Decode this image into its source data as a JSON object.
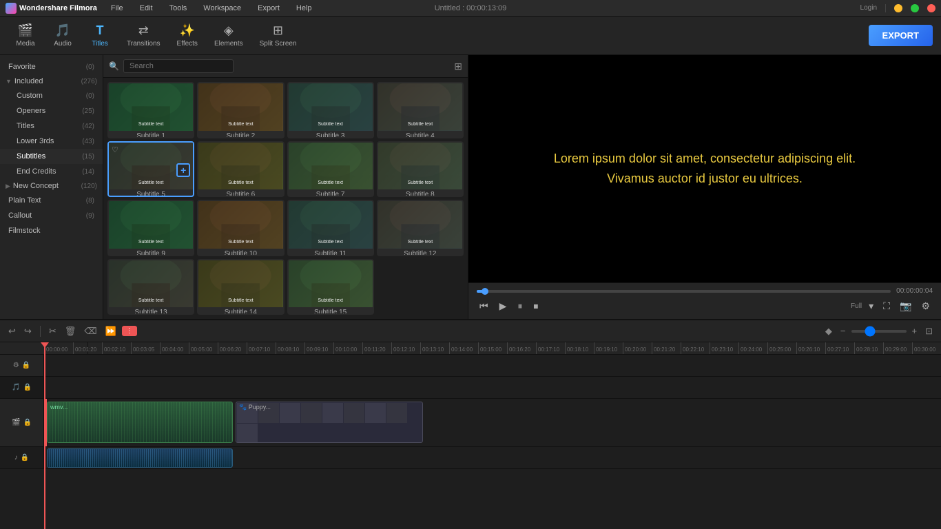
{
  "app": {
    "name": "Wondershare Filmora",
    "title": "Untitled : 00:00:13:09"
  },
  "menu": {
    "items": [
      "File",
      "Edit",
      "Tools",
      "Workspace",
      "Export",
      "Help"
    ]
  },
  "toolbar": {
    "items": [
      {
        "id": "media",
        "label": "Media",
        "icon": "🎬"
      },
      {
        "id": "audio",
        "label": "Audio",
        "icon": "🎵"
      },
      {
        "id": "titles",
        "label": "Titles",
        "icon": "T",
        "active": true
      },
      {
        "id": "transitions",
        "label": "Transitions",
        "icon": "⇄"
      },
      {
        "id": "effects",
        "label": "Effects",
        "icon": "✨"
      },
      {
        "id": "elements",
        "label": "Elements",
        "icon": "◈"
      },
      {
        "id": "split_screen",
        "label": "Split Screen",
        "icon": "⊞"
      }
    ],
    "export_label": "EXPORT"
  },
  "sidebar": {
    "items": [
      {
        "id": "favorite",
        "label": "Favorite",
        "count": "0",
        "expandable": false
      },
      {
        "id": "included",
        "label": "Included",
        "count": "276",
        "expandable": true,
        "expanded": true
      },
      {
        "id": "custom",
        "label": "Custom",
        "count": "0",
        "indent": true
      },
      {
        "id": "openers",
        "label": "Openers",
        "count": "25",
        "indent": true
      },
      {
        "id": "titles",
        "label": "Titles",
        "count": "42",
        "indent": true
      },
      {
        "id": "lower3rds",
        "label": "Lower 3rds",
        "count": "43",
        "indent": true
      },
      {
        "id": "subtitles",
        "label": "Subtitles",
        "count": "15",
        "indent": true,
        "active": true
      },
      {
        "id": "end_credits",
        "label": "End Credits",
        "count": "14",
        "indent": true
      },
      {
        "id": "new_concept",
        "label": "New Concept",
        "count": "120",
        "expandable": true
      },
      {
        "id": "plain_text",
        "label": "Plain Text",
        "count": "8"
      },
      {
        "id": "callout",
        "label": "Callout",
        "count": "9"
      },
      {
        "id": "filmstock",
        "label": "Filmstock",
        "count": ""
      }
    ]
  },
  "search": {
    "placeholder": "Search"
  },
  "tiles": [
    {
      "id": 1,
      "label": "Subtitle 1",
      "selected": false
    },
    {
      "id": 2,
      "label": "Subtitle 2",
      "selected": false
    },
    {
      "id": 3,
      "label": "Subtitle 3",
      "selected": false
    },
    {
      "id": 4,
      "label": "Subtitle 4",
      "selected": false
    },
    {
      "id": 5,
      "label": "Subtitle 5",
      "selected": true,
      "add_visible": true
    },
    {
      "id": 6,
      "label": "Subtitle 6",
      "selected": false
    },
    {
      "id": 7,
      "label": "Subtitle 7",
      "selected": false
    },
    {
      "id": 8,
      "label": "Subtitle 8",
      "selected": false
    },
    {
      "id": 9,
      "label": "Subtitle 9",
      "selected": false
    },
    {
      "id": 10,
      "label": "Subtitle 10",
      "selected": false
    },
    {
      "id": 11,
      "label": "Subtitle 11",
      "selected": false
    },
    {
      "id": 12,
      "label": "Subtitle 12",
      "selected": false
    },
    {
      "id": 13,
      "label": "Subtitle 13",
      "selected": false
    },
    {
      "id": 14,
      "label": "Subtitle 14",
      "selected": false
    },
    {
      "id": 15,
      "label": "Subtitle 15",
      "selected": false
    }
  ],
  "preview": {
    "text_line1": "Lorem ipsum dolor sit amet, consectetur adipiscing elit.",
    "text_line2": "Vivamus auctor id justor eu ultrices.",
    "time_current": "00:00:00:04",
    "time_total": "",
    "progress_percent": 2,
    "zoom_label": "Full"
  },
  "timeline": {
    "toolbar_buttons": [
      "undo",
      "redo",
      "cut",
      "delete",
      "ripple_delete",
      "speed",
      "split"
    ],
    "ruler_marks": [
      "00:00:00",
      "00:01:20",
      "00:02:10",
      "00:03:05",
      "00:04:00",
      "00:05:00",
      "00:06:20",
      "00:07:10",
      "00:08:10",
      "00:09:10",
      "00:10:00",
      "00:11:20",
      "00:12:10",
      "00:13:10",
      "00:14:00",
      "00:15:00",
      "00:16:20",
      "00:17:10",
      "00:18:10",
      "00:19:10",
      "00:20:00",
      "00:21:20",
      "00:22:10",
      "00:23:10",
      "00:24:00",
      "00:25:00",
      "00:26:10",
      "00:27:10",
      "00:28:10",
      "00:29:00",
      "00:30:00"
    ],
    "tracks": [
      {
        "id": "track_empty1",
        "type": "empty"
      },
      {
        "id": "track_main",
        "type": "video",
        "has_clip": true,
        "clip_label": "main_clip"
      },
      {
        "id": "track_puppy",
        "type": "video",
        "has_clip": true,
        "clip_label": "puppy_clip"
      }
    ]
  },
  "colors": {
    "accent": "#4a9eff",
    "preview_text": "#e8c940",
    "active_tab": "#4db8ff",
    "playhead": "#ee5555",
    "export_bg": "#2563eb",
    "selected_border": "#4a9eff"
  }
}
